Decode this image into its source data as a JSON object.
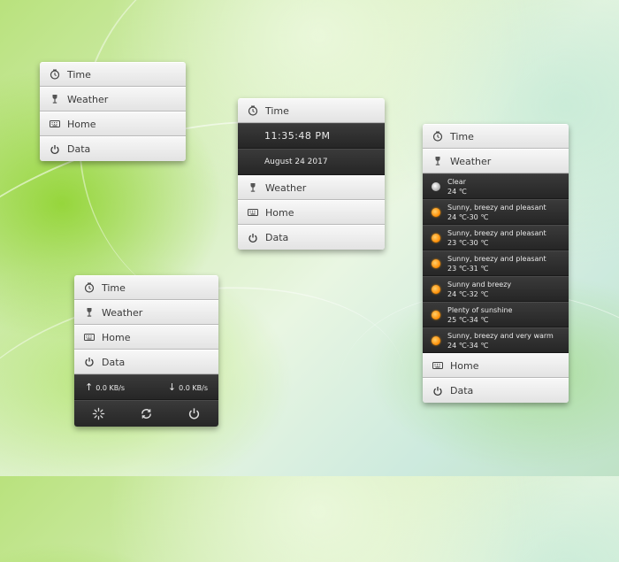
{
  "icons": {
    "time": "clock-icon",
    "weather": "goblet-icon",
    "home": "keyboard-icon",
    "data": "power-icon"
  },
  "menu": {
    "time": "Time",
    "weather": "Weather",
    "home": "Home",
    "data": "Data"
  },
  "clock": {
    "time": "11:35:48  PM",
    "date": "August 24  2017"
  },
  "weather": {
    "items": [
      {
        "condition": "Clear",
        "temp": "24 ℃",
        "icon": "moon-icon"
      },
      {
        "condition": "Sunny, breezy and pleasant",
        "temp": "24 ℃-30 ℃",
        "icon": "sun-icon"
      },
      {
        "condition": "Sunny, breezy and pleasant",
        "temp": "23 ℃-30 ℃",
        "icon": "sun-icon"
      },
      {
        "condition": "Sunny, breezy and pleasant",
        "temp": "23 ℃-31 ℃",
        "icon": "sun-icon"
      },
      {
        "condition": "Sunny and breezy",
        "temp": "24 ℃-32 ℃",
        "icon": "sun-icon"
      },
      {
        "condition": "Plenty of sunshine",
        "temp": "25 ℃-34 ℃",
        "icon": "sun-icon"
      },
      {
        "condition": "Sunny, breezy and very warm",
        "temp": "24 ℃-34 ℃",
        "icon": "sun-icon"
      }
    ]
  },
  "network": {
    "upload": "0.0  KB/s",
    "download": "0.0  KB/s",
    "upload_arrow": "↑",
    "download_arrow": "↓"
  },
  "colors": {
    "row_light": "#efefef",
    "panel_dark": "#2e2e2e",
    "sun": "#ff8a00"
  }
}
